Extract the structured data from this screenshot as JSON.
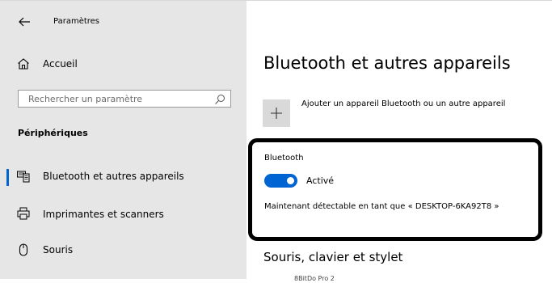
{
  "window": {
    "title": "Paramètres"
  },
  "sidebar": {
    "home_label": "Accueil",
    "search_placeholder": "Rechercher un paramètre",
    "section_title": "Périphériques",
    "items": [
      {
        "label": "Bluetooth et autres appareils",
        "icon": "bluetooth-devices-icon",
        "selected": true
      },
      {
        "label": "Imprimantes et scanners",
        "icon": "printer-icon",
        "selected": false
      },
      {
        "label": "Souris",
        "icon": "mouse-icon",
        "selected": false
      }
    ]
  },
  "main": {
    "page_title": "Bluetooth et autres appareils",
    "add_device_label": "Ajouter un appareil Bluetooth ou un autre appareil",
    "bluetooth": {
      "heading": "Bluetooth",
      "toggle_state": "Activé",
      "toggle_on": true,
      "discoverable_text": "Maintenant détectable en tant que « DESKTOP-6KA92T8 »"
    },
    "subsection_title": "Souris, clavier et stylet",
    "cut_off_text": "8BitDo Pro 2"
  },
  "colors": {
    "accent": "#0064d2",
    "sidebar_background": "#e6e6e6",
    "plus_tile": "#d9d9d9",
    "highlight_border": "#000000"
  }
}
